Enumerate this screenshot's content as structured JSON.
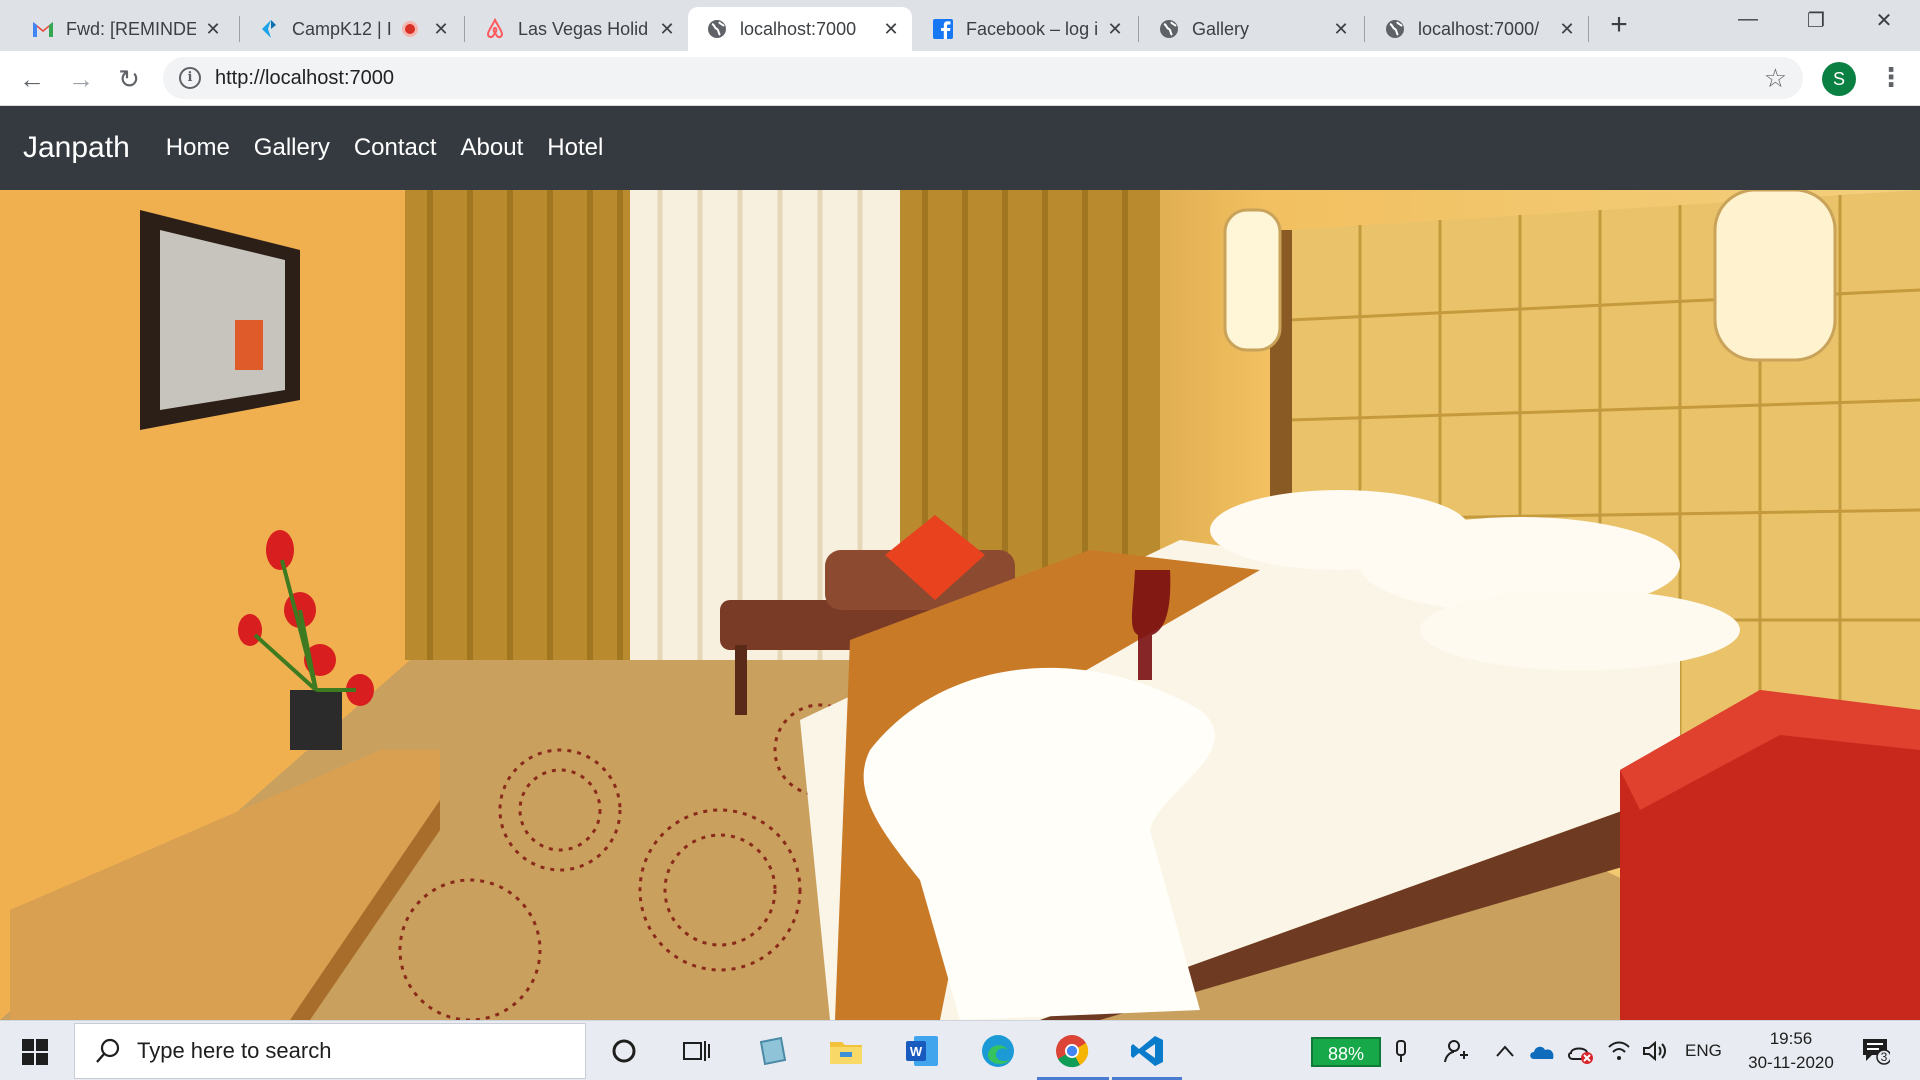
{
  "browser": {
    "tabs": [
      {
        "title": "Fwd: [REMINDER",
        "icon": "gmail-icon",
        "active": false
      },
      {
        "title": "CampK12 | I",
        "icon": "campk12-icon",
        "active": false,
        "recording": true
      },
      {
        "title": "Las Vegas Holid",
        "icon": "airbnb-icon",
        "active": false
      },
      {
        "title": "localhost:7000",
        "icon": "globe-icon",
        "active": true
      },
      {
        "title": "Facebook – log i",
        "icon": "facebook-icon",
        "active": false
      },
      {
        "title": "Gallery",
        "icon": "globe-icon",
        "active": false
      },
      {
        "title": "localhost:7000/",
        "icon": "globe-icon",
        "active": false
      }
    ],
    "new_tab_label": "+",
    "url": "http://localhost:7000",
    "profile_initial": "S"
  },
  "site": {
    "brand": "Janpath",
    "nav": [
      "Home",
      "Gallery",
      "Contact",
      "About",
      "Hotel"
    ]
  },
  "taskbar": {
    "search_placeholder": "Type here to search",
    "battery": "88%",
    "language": "ENG",
    "time": "19:56",
    "date": "30-11-2020",
    "notification_count": "3"
  },
  "colors": {
    "navbar": "#343a40",
    "tabstrip": "#dee1e6",
    "profile": "#0b8043",
    "battery": "#17a849"
  }
}
